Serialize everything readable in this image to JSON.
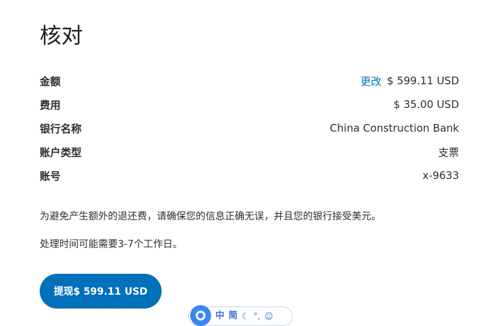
{
  "page": {
    "title": "核对"
  },
  "details": {
    "amount": {
      "label": "金额",
      "change_link": "更改",
      "value": "$ 599.11 USD"
    },
    "fee": {
      "label": "费用",
      "value": "$ 35.00 USD"
    },
    "bank_name": {
      "label": "银行名称",
      "value": "China Construction Bank"
    },
    "account_type": {
      "label": "账户类型",
      "value": "支票"
    },
    "account_number": {
      "label": "账号",
      "value": "x-9633"
    }
  },
  "notice_text": "为避免产生额外的退还费，请确保您的信息正确无误，并且您的银行接受美元。",
  "processing_text": "处理时间可能需要3-7个工作日。",
  "withdraw_button": {
    "label": "提现$ 599.11 USD",
    "color": "#0070ba"
  },
  "ime_toolbar": {
    "lang": "中",
    "mode": "简",
    "moon_icon": "moon-icon",
    "punct_icon": "punctuation-icon",
    "emoji_icon": "smiley-icon"
  },
  "colors": {
    "link": "#0070ba",
    "text": "#2c2e2f"
  }
}
